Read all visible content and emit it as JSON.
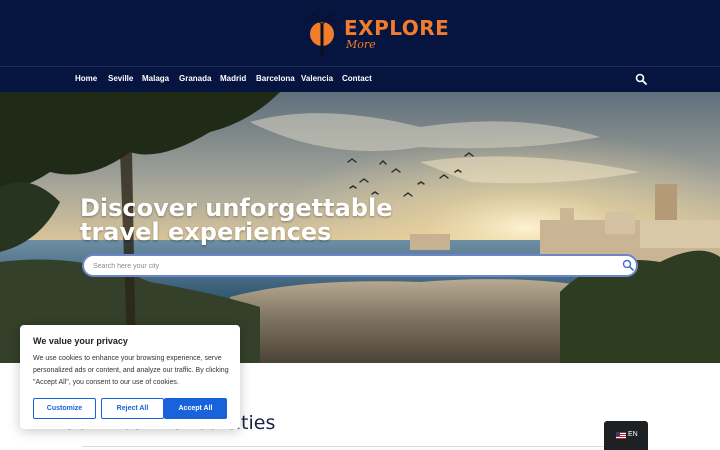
{
  "brand": {
    "name": "EXPLORE",
    "tagline": "More",
    "accent_color": "#f07c2c",
    "header_bg": "#061540",
    "logo_icon": "palm-tree-icon"
  },
  "nav": {
    "items": [
      {
        "label": "Home"
      },
      {
        "label": "Seville"
      },
      {
        "label": "Malaga"
      },
      {
        "label": "Granada"
      },
      {
        "label": "Madrid"
      },
      {
        "label": "Barcelona"
      },
      {
        "label": "Valencia"
      },
      {
        "label": "Contact"
      }
    ],
    "search_icon": "search-icon"
  },
  "hero": {
    "title_line1": "Discover unforgettable",
    "title_line2": "travel experiences",
    "search_placeholder": "Search here your city",
    "search_icon": "search-icon"
  },
  "section": {
    "title": "Our most visited cities"
  },
  "cookie": {
    "title": "We value your privacy",
    "text": "We use cookies to enhance your browsing experience, serve personalized ads or content, and analyze our traffic. By clicking \"Accept All\", you consent to our use of cookies.",
    "customize_label": "Customize",
    "reject_label": "Reject All",
    "accept_label": "Accept All",
    "button_color": "#1863dc"
  },
  "language": {
    "code": "EN",
    "flag_icon": "us-flag-icon"
  }
}
